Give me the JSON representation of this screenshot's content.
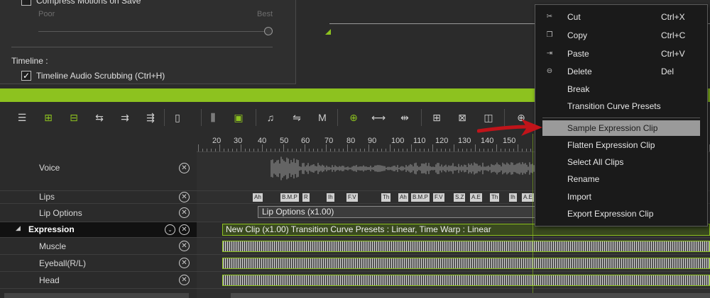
{
  "settings": {
    "compress_label": "Compress Motions on Save",
    "slider_min_label": "Poor",
    "slider_max_label": "Best",
    "timeline_heading": "Timeline :",
    "audio_scrub_label": "Timeline Audio Scrubbing (Ctrl+H)",
    "audio_scrub_checked": true,
    "checkmark": "✓"
  },
  "ruler": {
    "ticks": [
      "20",
      "30",
      "40",
      "50",
      "60",
      "70",
      "80",
      "90",
      "100",
      "110",
      "120",
      "130",
      "140",
      "150"
    ]
  },
  "tracks": [
    {
      "label": "Voice"
    },
    {
      "label": "Lips"
    },
    {
      "label": "Lip Options"
    },
    {
      "label": "Expression",
      "toggle": "◢"
    },
    {
      "label": "Muscle"
    },
    {
      "label": "Eyeball(R/L)"
    },
    {
      "label": "Head"
    }
  ],
  "track_remove_glyph": "✕",
  "track_collapse_glyph": "⌄",
  "phonemes": [
    "Ah",
    "B.M.P",
    "R",
    "Ih",
    "F.V",
    "Th",
    "Ah",
    "B.M.P",
    "F.V",
    "S.Z",
    "A.E",
    "Th",
    "Ih",
    "A.E"
  ],
  "clips": {
    "lip_options": "Lip Options (x1.00)",
    "expression": "New Clip (x1.00) Transition Curve Presets : Linear, Time Warp : Linear"
  },
  "context_menu": {
    "items": [
      {
        "label": "Cut",
        "shortcut": "Ctrl+X",
        "icon": "cut-icon",
        "glyph": "✂"
      },
      {
        "label": "Copy",
        "shortcut": "Ctrl+C",
        "icon": "copy-icon",
        "glyph": "❐"
      },
      {
        "label": "Paste",
        "shortcut": "Ctrl+V",
        "icon": "paste-icon",
        "glyph": "⇥"
      },
      {
        "label": "Delete",
        "shortcut": "Del",
        "icon": "delete-icon",
        "glyph": "⊖"
      },
      {
        "label": "Break",
        "shortcut": ""
      },
      {
        "label": "Transition Curve Presets",
        "shortcut": ""
      },
      {
        "label": "Sample Expression Clip",
        "shortcut": "",
        "highlighted": true
      },
      {
        "label": "Flatten Expression Clip",
        "shortcut": ""
      },
      {
        "label": "Select All Clips",
        "shortcut": ""
      },
      {
        "label": "Rename",
        "shortcut": ""
      },
      {
        "label": "Import",
        "shortcut": ""
      },
      {
        "label": "Export Expression Clip",
        "shortcut": ""
      }
    ]
  },
  "toolbar": {
    "icons": [
      {
        "name": "track-list-icon",
        "glyph": "☰",
        "green": false
      },
      {
        "name": "add-key-icon",
        "glyph": "⊞",
        "green": true
      },
      {
        "name": "insert-track-icon",
        "glyph": "⊟",
        "green": true
      },
      {
        "name": "move-left-icon",
        "glyph": "⇆",
        "green": false
      },
      {
        "name": "insert-icon",
        "glyph": "⇉",
        "green": false
      },
      {
        "name": "move-right-icon",
        "glyph": "⇶",
        "green": false
      },
      {
        "name": "file-icon",
        "glyph": "▯",
        "green": false
      },
      {
        "name": "split-icon",
        "glyph": "⫼",
        "green": false
      },
      {
        "name": "clip-green-icon",
        "glyph": "▣",
        "green": true
      },
      {
        "name": "music-note-icon",
        "glyph": "♫",
        "green": false
      },
      {
        "name": "transfer-icon",
        "glyph": "⇋",
        "green": false
      },
      {
        "name": "motion-icon",
        "glyph": "M",
        "green": false
      },
      {
        "name": "add-clip-icon",
        "glyph": "⊕",
        "green": true
      },
      {
        "name": "stretch-icon",
        "glyph": "⟷",
        "green": false
      },
      {
        "name": "fit-icon",
        "glyph": "⇹",
        "green": false
      },
      {
        "name": "insert-frame-icon",
        "glyph": "⊞",
        "green": false
      },
      {
        "name": "delete-frame-icon",
        "glyph": "⊠",
        "green": false
      },
      {
        "name": "columns-icon",
        "glyph": "◫",
        "green": false
      },
      {
        "name": "zoom-in-icon",
        "glyph": "⊕",
        "green": false
      }
    ]
  }
}
